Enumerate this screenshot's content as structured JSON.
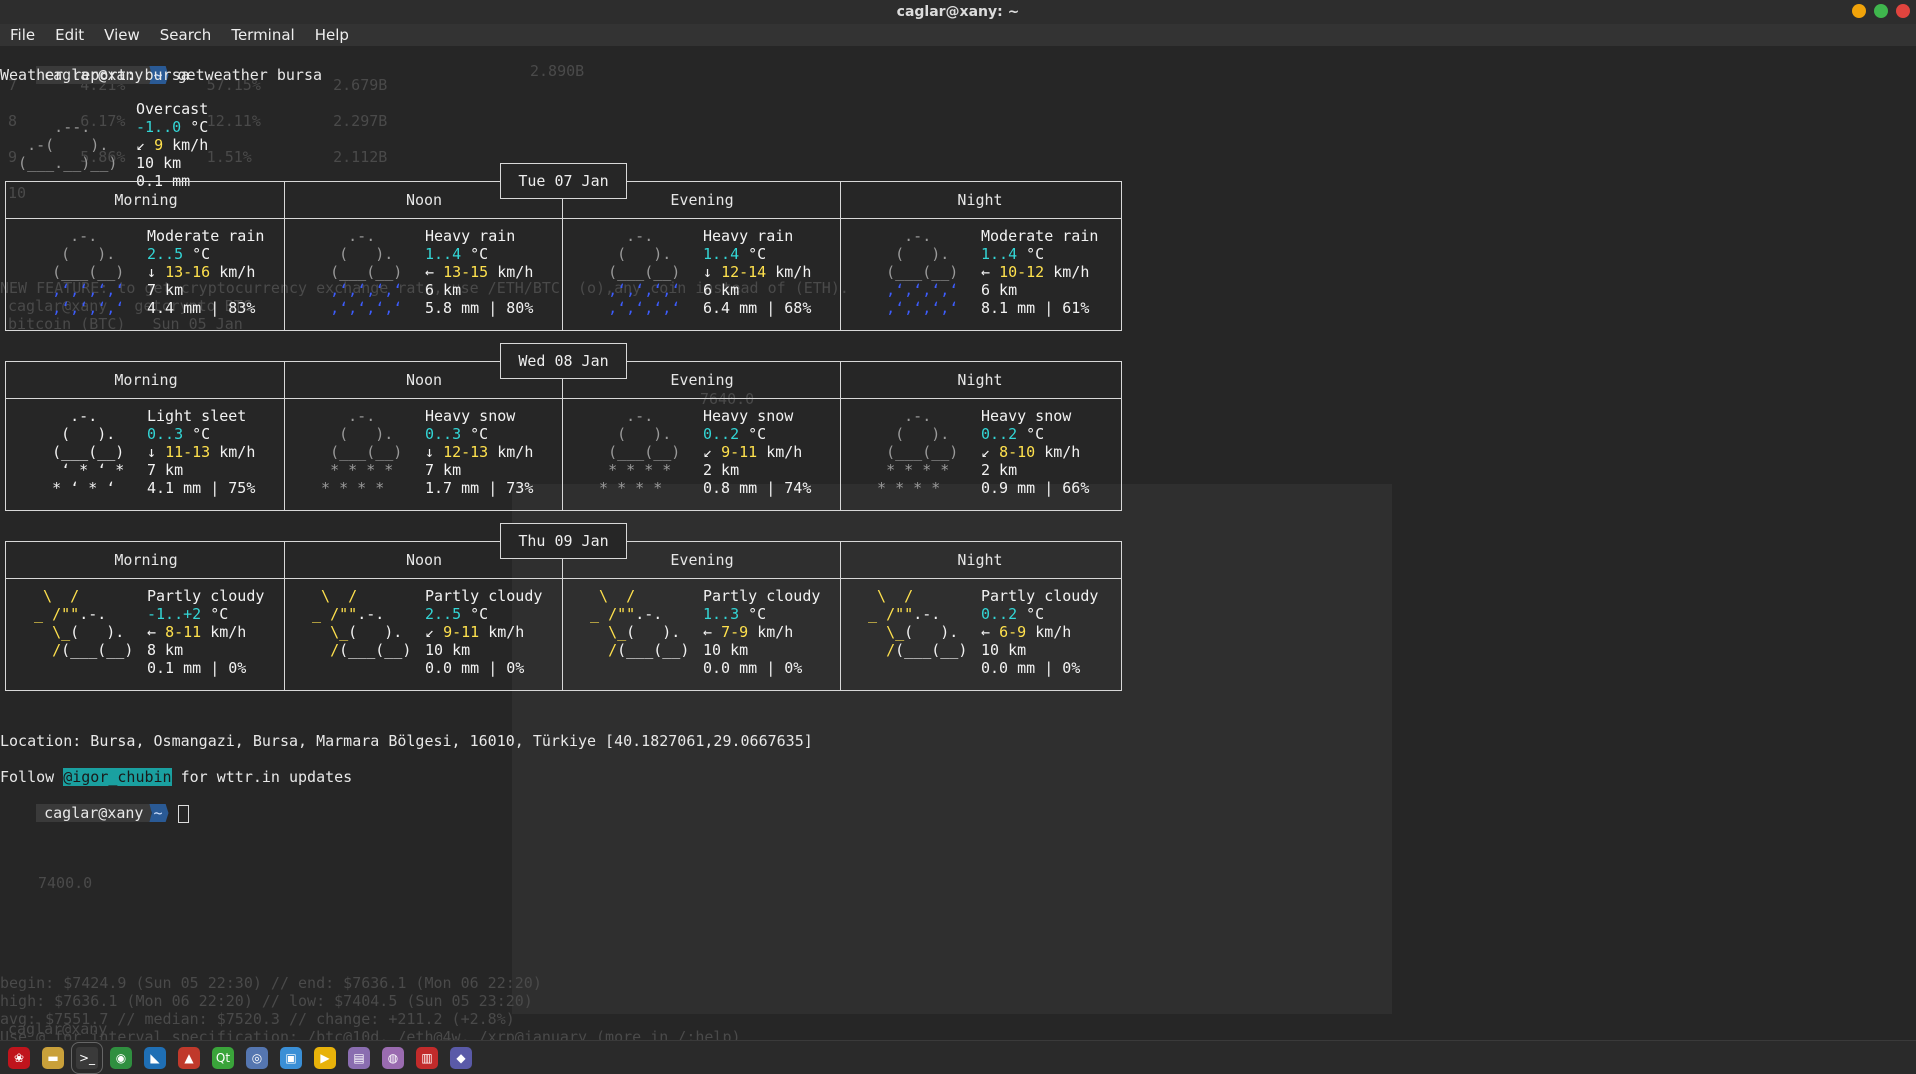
{
  "window": {
    "title": "caglar@xany: ~",
    "buttons": [
      {
        "name": "minimize-button",
        "color": "#f0a30a"
      },
      {
        "name": "maximize-button",
        "color": "#3fb64d"
      },
      {
        "name": "close-button",
        "color": "#e0443e"
      }
    ]
  },
  "menu": [
    "File",
    "Edit",
    "View",
    "Search",
    "Terminal",
    "Help"
  ],
  "prompt": {
    "user": "caglar@xany",
    "dir": "~",
    "command": "getweather bursa"
  },
  "report_title": "Weather report: bursa",
  "current": {
    "condition": "Overcast",
    "temp": "-1..0",
    "temp_unit": "°C",
    "wind_arrow": "↙",
    "wind": "9",
    "wind_unit": "km/h",
    "visibility": "10 km",
    "precip": "0.1 mm",
    "art": [
      "      .--.    ",
      "   .-(    ).  ",
      "  (___.__)__) "
    ]
  },
  "days": [
    {
      "date": "Tue 07 Jan",
      "periods": [
        {
          "name": "Morning",
          "condition": "Moderate rain",
          "temp": "2..5",
          "wind_arrow": "↓",
          "wind": "13-16",
          "vis": "7 km",
          "precip": "4.4 mm | 83%",
          "icon": "rain"
        },
        {
          "name": "Noon",
          "condition": "Heavy rain",
          "temp": "1..4",
          "wind_arrow": "←",
          "wind": "13-15",
          "vis": "6 km",
          "precip": "5.8 mm | 80%",
          "icon": "rain"
        },
        {
          "name": "Evening",
          "condition": "Heavy rain",
          "temp": "1..4",
          "wind_arrow": "↓",
          "wind": "12-14",
          "vis": "6 km",
          "precip": "6.4 mm | 68%",
          "icon": "rain"
        },
        {
          "name": "Night",
          "condition": "Moderate rain",
          "temp": "1..4",
          "wind_arrow": "←",
          "wind": "10-12",
          "vis": "6 km",
          "precip": "8.1 mm | 61%",
          "icon": "rain"
        }
      ]
    },
    {
      "date": "Wed 08 Jan",
      "periods": [
        {
          "name": "Morning",
          "condition": "Light sleet",
          "temp": "0..3",
          "wind_arrow": "↓",
          "wind": "11-13",
          "vis": "7 km",
          "precip": "4.1 mm | 75%",
          "icon": "sleet"
        },
        {
          "name": "Noon",
          "condition": "Heavy snow",
          "temp": "0..3",
          "wind_arrow": "↓",
          "wind": "12-13",
          "vis": "7 km",
          "precip": "1.7 mm | 73%",
          "icon": "snow"
        },
        {
          "name": "Evening",
          "condition": "Heavy snow",
          "temp": "0..2",
          "wind_arrow": "↙",
          "wind": "9-11",
          "vis": "2 km",
          "precip": "0.8 mm | 74%",
          "icon": "snow"
        },
        {
          "name": "Night",
          "condition": "Heavy snow",
          "temp": "0..2",
          "wind_arrow": "↙",
          "wind": "8-10",
          "vis": "2 km",
          "precip": "0.9 mm | 66%",
          "icon": "snow"
        }
      ]
    },
    {
      "date": "Thu 09 Jan",
      "periods": [
        {
          "name": "Morning",
          "condition": "Partly cloudy",
          "temp": "-1..+2",
          "wind_arrow": "←",
          "wind": "8-11",
          "vis": "8 km",
          "precip": "0.1 mm | 0%",
          "icon": "partly"
        },
        {
          "name": "Noon",
          "condition": "Partly cloudy",
          "temp": "2..5",
          "wind_arrow": "↙",
          "wind": "9-11",
          "vis": "10 km",
          "precip": "0.0 mm | 0%",
          "icon": "partly"
        },
        {
          "name": "Evening",
          "condition": "Partly cloudy",
          "temp": "1..3",
          "wind_arrow": "←",
          "wind": "7-9",
          "vis": "10 km",
          "precip": "0.0 mm | 0%",
          "icon": "partly"
        },
        {
          "name": "Night",
          "condition": "Partly cloudy",
          "temp": "0..2",
          "wind_arrow": "←",
          "wind": "6-9",
          "vis": "10 km",
          "precip": "0.0 mm | 0%",
          "icon": "partly"
        }
      ]
    }
  ],
  "location": "Location: Bursa, Osmangazi, Bursa, Marmara Bölgesi, 16010, Türkiye [40.1827061,29.0667635]",
  "follow": {
    "pre": "Follow ",
    "handle": "@igor_chubin",
    "post": " for wttr.in updates"
  },
  "ghost_lines": [
    "begin: $7424.9 (Sun 05 22:30) // end: $7636.1 (Mon 06 22:20)",
    "high: $7636.1 (Mon 06 22:20) // low: $7404.5 (Sun 05 23:20)",
    "avg: $7551.7 // median: $7520.3 // change: +211.2 (+2.8%)",
    "Use @ for interval specification: /btc@10d, /eth@4w, /xrp@january (more in /:help)"
  ],
  "ghost_table": [
    {
      "rank": "7",
      "v1": "4.21%",
      "v2": "57.15%",
      "v3": "2.679B"
    },
    {
      "rank": "8",
      "v1": "6.17%",
      "v2": "12.11%",
      "v3": "2.297B"
    },
    {
      "rank": "9",
      "v1": "5.86%",
      "v2": "1.51%",
      "v3": "2.112B"
    },
    {
      "rank": "10",
      "v1": "",
      "v2": "",
      "v3": ""
    }
  ],
  "ghost_top_value": "2.890B",
  "ghost_axis": "7400.0",
  "ghost_mid": "7640.0",
  "ghost_news": "NEW FEATURE: to get cryptocurrency exchange rate, use /ETH/BTC  (o),any coin instead of (ETH).",
  "ghost_cmd": "caglar@xany   getcrypto BTC",
  "ghost_btc": "bitcoin (BTC)   Sun 05 Jan",
  "taskbar": [
    {
      "name": "debian-icon",
      "color": "#c0141c",
      "glyph": "❀"
    },
    {
      "name": "files-icon",
      "color": "#c9a03a",
      "glyph": "▬"
    },
    {
      "name": "terminal-icon",
      "color": "#3a3a3a",
      "glyph": ">_"
    },
    {
      "name": "chrome-icon",
      "color": "#2f8f3f",
      "glyph": "◉"
    },
    {
      "name": "vscode-icon",
      "color": "#1f6fb5",
      "glyph": "◣"
    },
    {
      "name": "drive-icon",
      "color": "#c0392b",
      "glyph": "▲"
    },
    {
      "name": "qt-icon",
      "color": "#3aa43a",
      "glyph": "Qt"
    },
    {
      "name": "disk-icon",
      "color": "#5576b0",
      "glyph": "◎"
    },
    {
      "name": "screenshot-icon",
      "color": "#3a8fd6",
      "glyph": "▣"
    },
    {
      "name": "media-player-icon",
      "color": "#e8b20a",
      "glyph": "▶"
    },
    {
      "name": "notes-icon",
      "color": "#8a6db0",
      "glyph": "▤"
    },
    {
      "name": "webcam-icon",
      "color": "#9a6bb0",
      "glyph": "◍"
    },
    {
      "name": "popcorn-icon",
      "color": "#c22b2b",
      "glyph": "▥"
    },
    {
      "name": "remote-icon",
      "color": "#5a5aa8",
      "glyph": "◆"
    }
  ]
}
